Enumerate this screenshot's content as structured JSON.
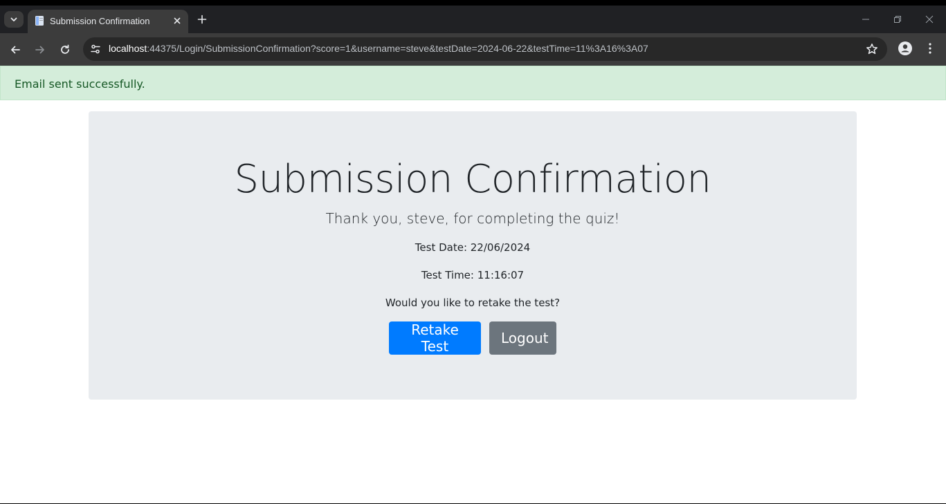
{
  "browser": {
    "tab": {
      "title": "Submission Confirmation"
    },
    "address_bar": {
      "url_host": "localhost",
      "url_rest": ":44375/Login/SubmissionConfirmation?score=1&username=steve&testDate=2024-06-22&testTime=11%3A16%3A07"
    }
  },
  "page": {
    "alert": {
      "message": "Email sent successfully."
    },
    "confirmation": {
      "heading": "Submission Confirmation",
      "thank_you": "Thank you, steve, for completing the quiz!",
      "test_date": "Test Date: 22/06/2024",
      "test_time": "Test Time: 11:16:07",
      "retake_prompt": "Would you like to retake the test?",
      "retake_button": "Retake Test",
      "logout_button": "Logout"
    }
  },
  "colors": {
    "alert_bg": "#d4edda",
    "alert_text": "#155724",
    "jumbotron_bg": "#e9ecef",
    "primary": "#007bff",
    "secondary": "#6c757d"
  }
}
